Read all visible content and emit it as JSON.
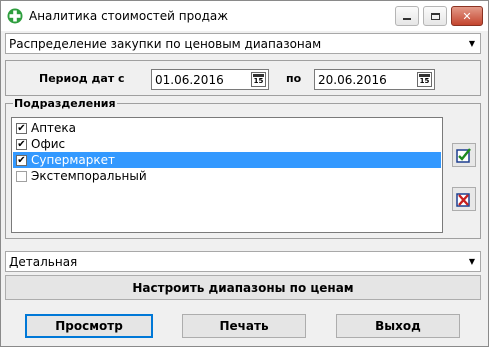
{
  "window": {
    "title": "Аналитика стоимостей продаж",
    "controls": {
      "minimize": "minimize-icon",
      "maximize": "maximize-icon",
      "close": "✕"
    }
  },
  "report_type": {
    "selected": "Распределение закупки по ценовым диапазонам"
  },
  "period": {
    "from_label": "Период дат с",
    "from_value": "01.06.2016",
    "to_label": "по",
    "to_value": "20.06.2016",
    "calendar_icon_text": "15"
  },
  "divisions": {
    "title": "Подразделения",
    "items": [
      {
        "label": "Аптека",
        "checked": true
      },
      {
        "label": "Офис",
        "checked": true
      },
      {
        "label": "Супермаркет",
        "checked": true,
        "selected": true
      },
      {
        "label": "Экстемпоральный",
        "checked": false
      }
    ]
  },
  "detail_mode": {
    "selected": "Детальная"
  },
  "configure_ranges_button": "Настроить диапазоны по ценам",
  "buttons": {
    "preview": "Просмотр",
    "print": "Печать",
    "exit": "Выход"
  },
  "colors": {
    "selection": "#3399ff",
    "close_button": "#c4452f",
    "focus_border": "#0078d7"
  }
}
